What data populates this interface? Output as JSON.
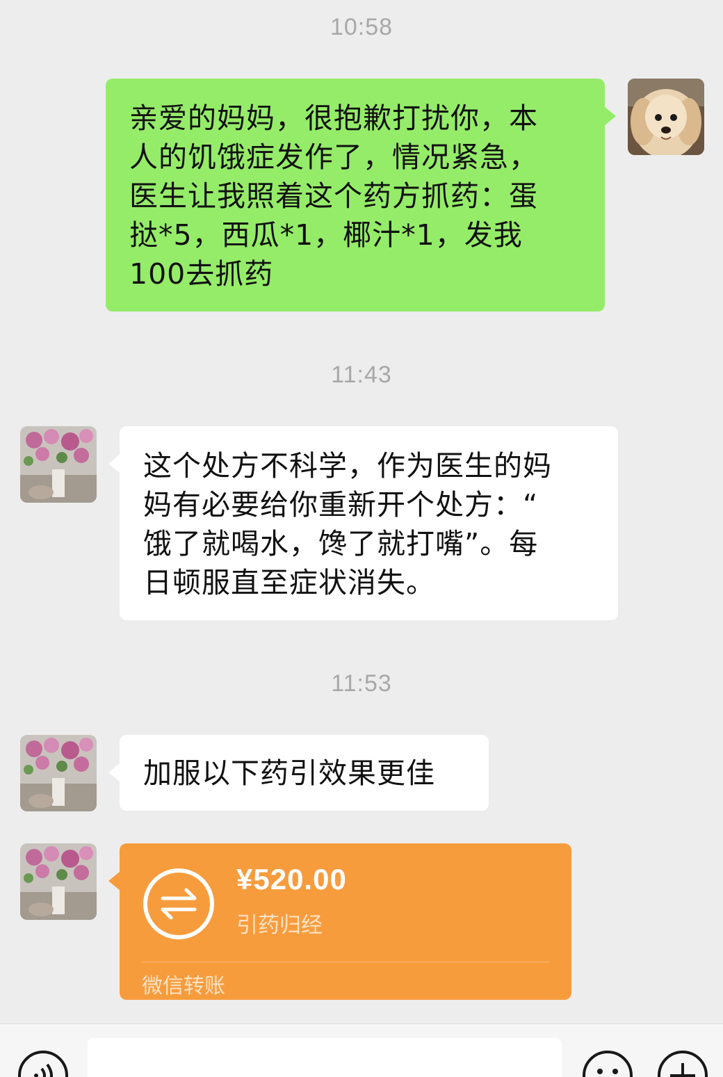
{
  "messages": [
    {
      "time": "10:58",
      "sender": "self",
      "text": "亲爱的妈妈，很抱歉打扰你，本人的饥饿症发作了，情况紧急，医生让我照着这个药方抓药：蛋挞*5，西瓜*1，椰汁*1，发我100去抓药"
    },
    {
      "time": "11:43",
      "sender": "mom",
      "text": "这个处方不科学，作为医生的妈妈有必要给你重新开个处方：“饿了就喝水，馋了就打嘴”。每日顿服直至症状消失。"
    },
    {
      "time": "11:53",
      "sender": "mom",
      "text": "加服以下药引效果更佳"
    }
  ],
  "lines": {
    "m1": [
      "亲爱的妈妈，很抱歉打扰你，本",
      "人的饥饿症发作了，情况紧急，",
      "医生让我照着这个药方抓药：蛋",
      "挞*5，西瓜*1，椰汁*1，发我",
      "100去抓药"
    ],
    "m2": [
      "这个处方不科学，作为医生的妈",
      "妈有必要给你重新开个处方：“",
      "饿了就喝水，馋了就打嘴”。每",
      "日顿服直至症状消失。"
    ]
  },
  "transfer": {
    "amount": "¥520.00",
    "note": "引药归经",
    "label": "微信转账",
    "icon": "transfer-arrows-icon"
  },
  "input_bar": {
    "voice_icon": "voice-icon",
    "emoji_icon": "emoji-icon",
    "plus_icon": "plus-icon"
  },
  "colors": {
    "background": "#ededed",
    "outgoing_bubble": "#95ec69",
    "incoming_bubble": "#ffffff",
    "transfer_card": "#f79c3d",
    "timestamp": "#a8a8a8"
  }
}
